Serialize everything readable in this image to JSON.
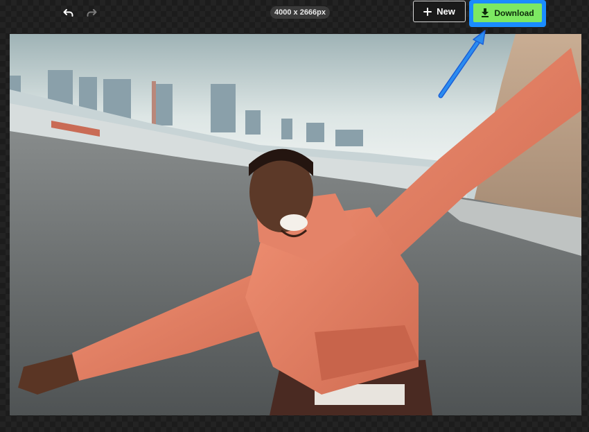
{
  "toolbar": {
    "undo_icon": "undo-icon",
    "redo_icon": "redo-icon",
    "dimensions": "4000 x 2666px",
    "new_label": "New",
    "new_icon": "plus-icon",
    "download_label": "Download",
    "download_icon": "download-icon"
  },
  "colors": {
    "download_bg": "#7ce862",
    "highlight": "#1a8cff",
    "canvas_bg": "#232323"
  },
  "canvas": {
    "image": "photo-man-orange-hoodie-arms-outstretched"
  }
}
